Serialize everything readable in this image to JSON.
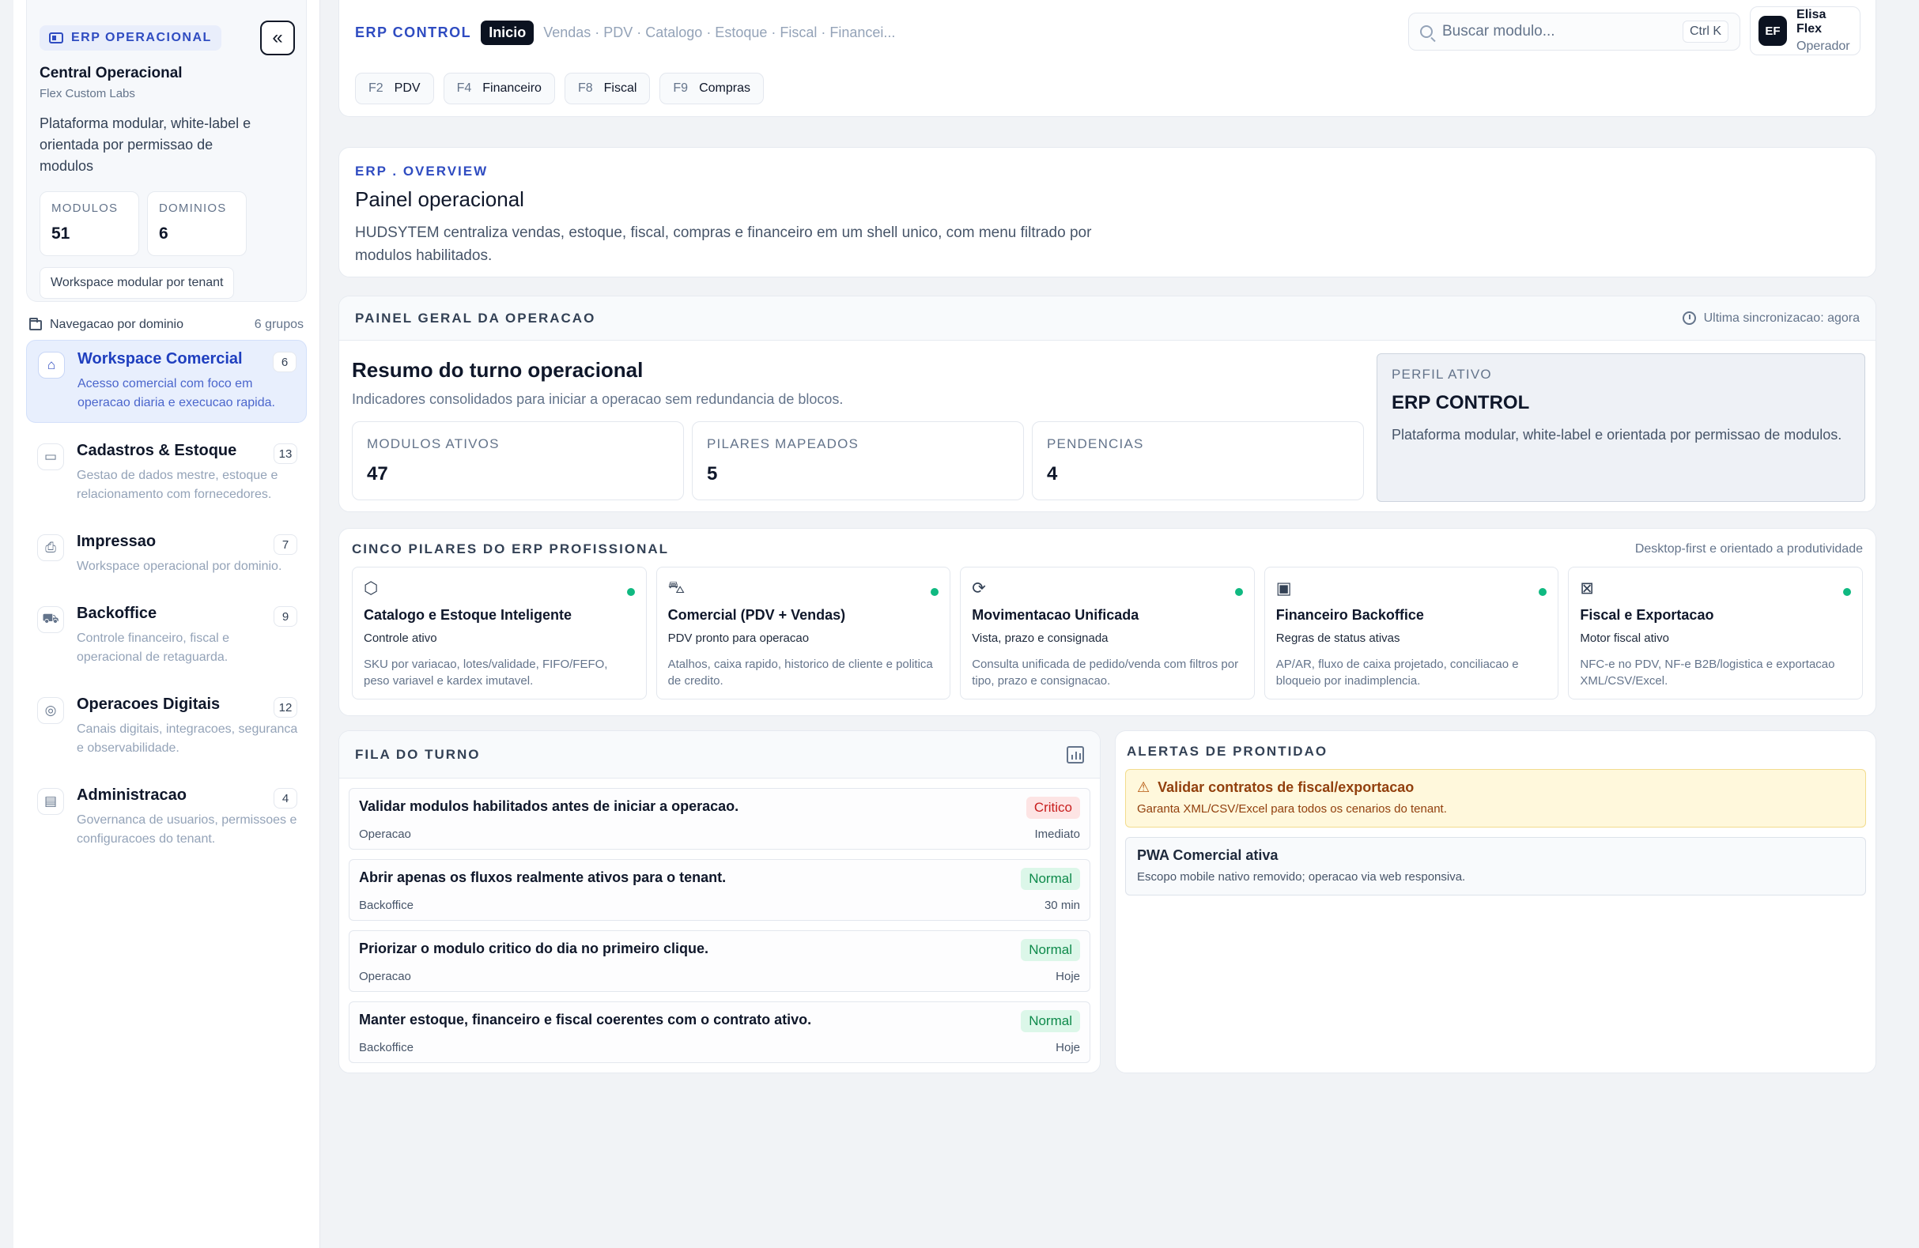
{
  "sidebar": {
    "brand_label": "ERP OPERACIONAL",
    "title": "Central Operacional",
    "subtitle": "Flex Custom Labs",
    "description": "Plataforma modular, white-label e orientada por permissao de modulos",
    "stats": [
      {
        "label": "MODULOS",
        "value": "51"
      },
      {
        "label": "DOMINIOS",
        "value": "6"
      }
    ],
    "tenant_chip": "Workspace modular por tenant",
    "nav_heading": "Navegacao por dominio",
    "nav_groups_count": "6 grupos",
    "items": [
      {
        "title": "Workspace Comercial",
        "count": "6",
        "desc": "Acesso comercial com foco em operacao diaria e execucao rapida.",
        "icon": "home-icon"
      },
      {
        "title": "Cadastros & Estoque",
        "count": "13",
        "desc": "Gestao de dados mestre, estoque e relacionamento com fornecedores.",
        "icon": "archive-icon"
      },
      {
        "title": "Impressao",
        "count": "7",
        "desc": "Workspace operacional por dominio.",
        "icon": "printer-icon"
      },
      {
        "title": "Backoffice",
        "count": "9",
        "desc": "Controle financeiro, fiscal e operacional de retaguarda.",
        "icon": "truck-icon"
      },
      {
        "title": "Operacoes Digitais",
        "count": "12",
        "desc": "Canais digitais, integracoes, seguranca e observabilidade.",
        "icon": "globe-icon"
      },
      {
        "title": "Administracao",
        "count": "4",
        "desc": "Governanca de usuarios, permissoes e configuracoes do tenant.",
        "icon": "id-card-icon"
      }
    ]
  },
  "topbar": {
    "brand": "ERP CONTROL",
    "home": "Inicio",
    "path": "Vendas · PDV · Catalogo · Estoque · Fiscal · Financei...",
    "shortcuts": [
      {
        "key": "F2",
        "label": "PDV"
      },
      {
        "key": "F4",
        "label": "Financeiro"
      },
      {
        "key": "F8",
        "label": "Fiscal"
      },
      {
        "key": "F9",
        "label": "Compras"
      }
    ],
    "search_placeholder": "Buscar modulo...",
    "search_kbd": "Ctrl K",
    "user": {
      "initials": "EF",
      "name": "Elisa Flex",
      "role": "Operador"
    }
  },
  "overview": {
    "eyebrow": "ERP . OVERVIEW",
    "title": "Painel operacional",
    "description": "HUDSYTEM centraliza vendas, estoque, fiscal, compras e financeiro em um shell unico, com menu filtrado por modulos habilitados."
  },
  "painel": {
    "heading": "PAINEL GERAL DA OPERACAO",
    "sync": "Ultima sincronizacao: agora",
    "title": "Resumo do turno operacional",
    "subtitle": "Indicadores consolidados para iniciar a operacao sem redundancia de blocos.",
    "kpis": [
      {
        "label": "MODULOS ATIVOS",
        "value": "47"
      },
      {
        "label": "PILARES MAPEADOS",
        "value": "5"
      },
      {
        "label": "PENDENCIAS",
        "value": "4"
      }
    ],
    "perfil": {
      "label": "PERFIL ATIVO",
      "title": "ERP CONTROL",
      "desc": "Plataforma modular, white-label e orientada por permissao de modulos."
    }
  },
  "pilares": {
    "heading": "CINCO PILARES DO ERP PROFISSIONAL",
    "note": "Desktop-first e orientado a produtividade",
    "items": [
      {
        "title": "Catalogo e Estoque Inteligente",
        "sub": "Controle ativo",
        "desc": "SKU por variacao, lotes/validade, FIFO/FEFO, peso variavel e kardex imutavel.",
        "icon": "box-icon"
      },
      {
        "title": "Comercial (PDV + Vendas)",
        "sub": "PDV pronto para operacao",
        "desc": "Atalhos, caixa rapido, historico de cliente e politica de credito.",
        "icon": "cart-icon"
      },
      {
        "title": "Movimentacao Unificada",
        "sub": "Vista, prazo e consignada",
        "desc": "Consulta unificada de pedido/venda com filtros por tipo, prazo e consignacao.",
        "icon": "refresh-icon"
      },
      {
        "title": "Financeiro Backoffice",
        "sub": "Regras de status ativas",
        "desc": "AP/AR, fluxo de caixa projetado, conciliacao e bloqueio por inadimplencia.",
        "icon": "cash-icon"
      },
      {
        "title": "Fiscal e Exportacao",
        "sub": "Motor fiscal ativo",
        "desc": "NFC-e no PDV, NF-e B2B/logistica e exportacao XML/CSV/Excel.",
        "icon": "receipt-icon"
      }
    ]
  },
  "fila": {
    "heading": "FILA DO TURNO",
    "tasks": [
      {
        "title": "Validar modulos habilitados antes de iniciar a operacao.",
        "cat": "Operacao",
        "badge": "Critico",
        "level": "crit",
        "when": "Imediato"
      },
      {
        "title": "Abrir apenas os fluxos realmente ativos para o tenant.",
        "cat": "Backoffice",
        "badge": "Normal",
        "level": "norm",
        "when": "30 min"
      },
      {
        "title": "Priorizar o modulo critico do dia no primeiro clique.",
        "cat": "Operacao",
        "badge": "Normal",
        "level": "norm",
        "when": "Hoje"
      },
      {
        "title": "Manter estoque, financeiro e fiscal coerentes com o contrato ativo.",
        "cat": "Backoffice",
        "badge": "Normal",
        "level": "norm",
        "when": "Hoje"
      }
    ]
  },
  "alertas": {
    "heading": "ALERTAS DE PRONTIDAO",
    "warning": {
      "title": "Validar contratos de fiscal/exportacao",
      "desc": "Garanta XML/CSV/Excel para todos os cenarios do tenant."
    },
    "info": {
      "title": "PWA Comercial ativa",
      "desc": "Escopo mobile nativo removido; operacao via web responsiva."
    }
  },
  "colors": {
    "accent": "#2f4cc1",
    "dark": "#0b1220",
    "success": "#10b981",
    "critical": "#c81e1e",
    "warning_bg": "#fff8dc"
  }
}
